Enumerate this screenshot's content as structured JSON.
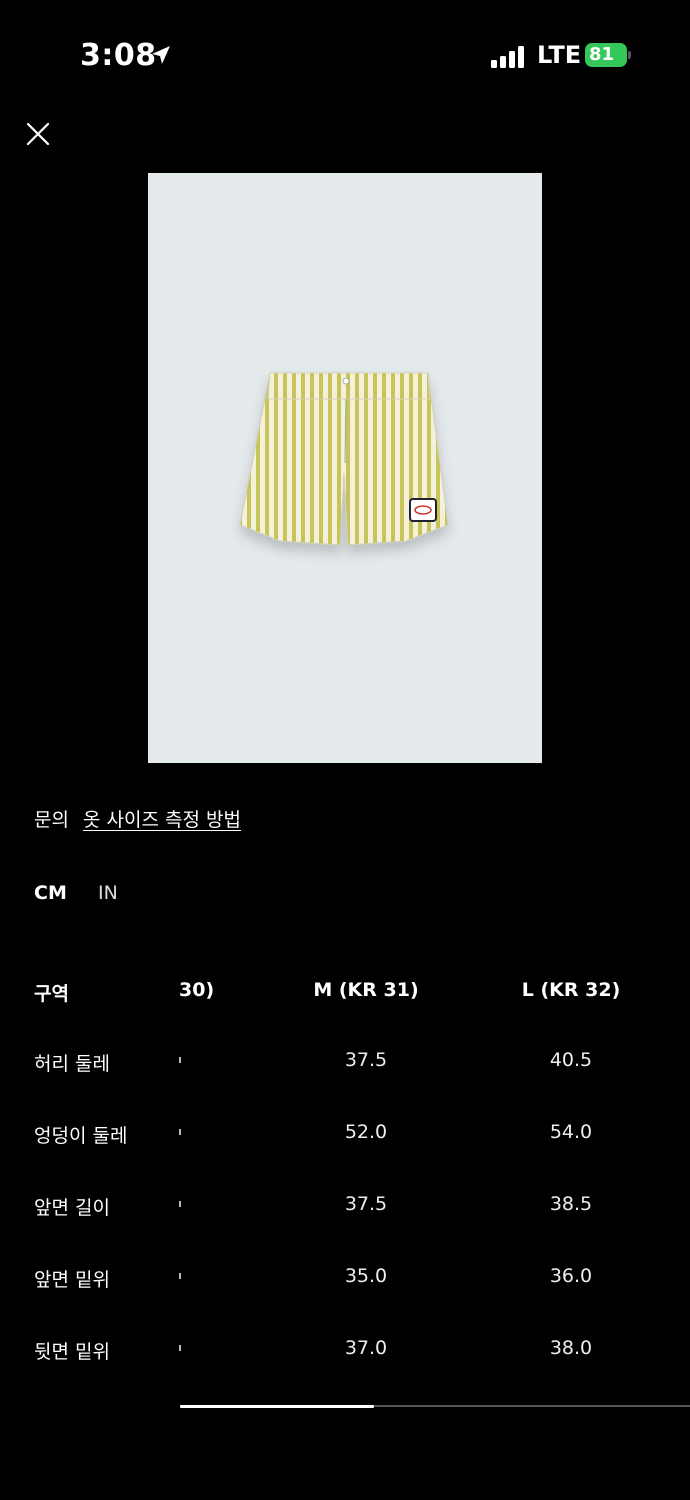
{
  "status_bar": {
    "time": "3:08",
    "network": "LTE",
    "battery": "81",
    "icons": [
      "location-arrow-icon",
      "signal-bars-icon",
      "battery-charging-icon"
    ]
  },
  "header": {
    "close_icon": "close-icon"
  },
  "links": {
    "help": "문의",
    "measure": "옷 사이즈 측정 방법"
  },
  "units": {
    "cm": "CM",
    "in": "IN",
    "selected": "CM"
  },
  "size_table": {
    "columns": {
      "label": "구역",
      "partial": "30)",
      "m": "M (KR 31)",
      "l": "L (KR 32)"
    },
    "rows": [
      {
        "label": "허리 둘레",
        "m": "37.5",
        "l": "40.5"
      },
      {
        "label": "엉덩이 둘레",
        "m": "52.0",
        "l": "54.0"
      },
      {
        "label": "앞면 길이",
        "m": "37.5",
        "l": "38.5"
      },
      {
        "label": "앞면 밑위",
        "m": "35.0",
        "l": "36.0"
      },
      {
        "label": "뒷면 밑위",
        "m": "37.0",
        "l": "38.0"
      }
    ]
  },
  "colors": {
    "background": "#000000",
    "image_background": "#e4e9ec",
    "battery": "#34c759",
    "stripe": "#c9c45a"
  },
  "scroll": {
    "position": 0.38
  }
}
